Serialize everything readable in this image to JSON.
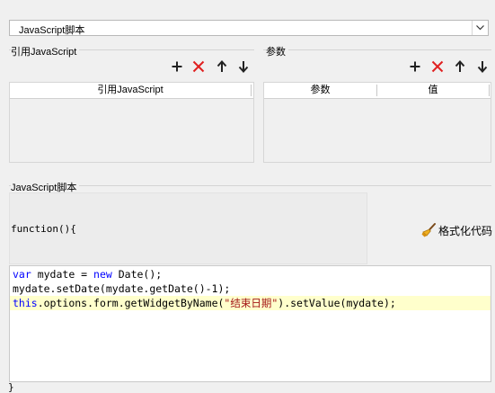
{
  "script_select": {
    "value": "JavaScript脚本"
  },
  "ref_js_group": {
    "title": "引用JavaScript",
    "columns": [
      "引用JavaScript"
    ]
  },
  "params_group": {
    "title": "参数",
    "columns": [
      "参数",
      "值"
    ]
  },
  "js_script_group": {
    "title": "JavaScript脚本",
    "function_signature": "function(){",
    "format_button_label": "格式化代码"
  },
  "code_editor": {
    "line1": {
      "kw1": "var",
      "t1": " mydate = ",
      "kw2": "new",
      "t2": " Date();"
    },
    "line2": {
      "t1": "mydate.setDate(mydate.getDate()-1);"
    },
    "line3": {
      "kw1": "this",
      "t1": ".options.form.getWidgetByName(",
      "str": "\"结束日期\"",
      "t2": ").setValue(mydate);"
    }
  },
  "footer": {
    "text": "}"
  },
  "icons": {
    "add": "plus-icon",
    "delete": "delete-x-icon",
    "move_up": "arrow-up-icon",
    "move_down": "arrow-down-icon",
    "format": "broom-icon",
    "dropdown": "chevron-down-icon"
  },
  "colors": {
    "delete_icon": "#e02020",
    "keyword": "#0000ff",
    "string": "#a31515",
    "current_line": "#ffffcc"
  }
}
